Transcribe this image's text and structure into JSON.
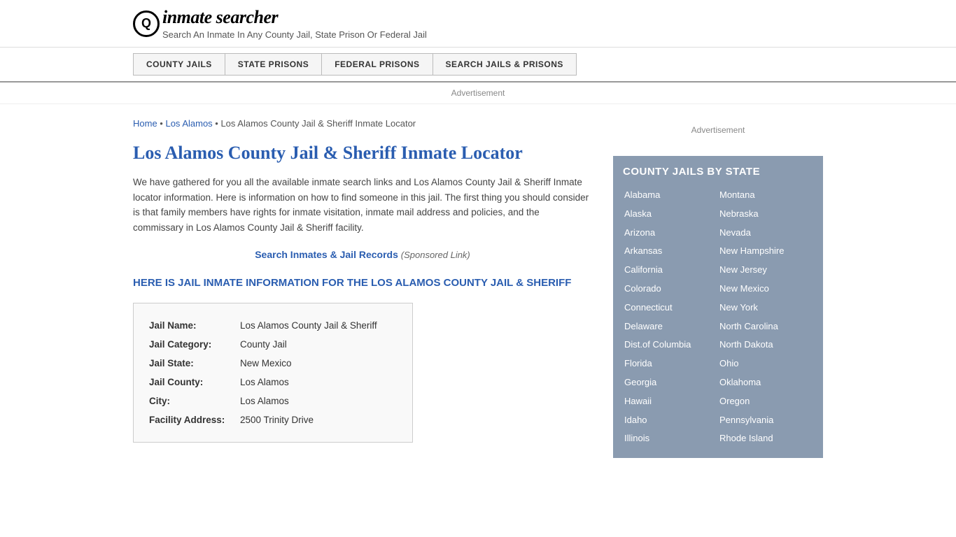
{
  "header": {
    "logo_icon": "🔍",
    "logo_text": "inmate searcher",
    "tagline": "Search An Inmate In Any County Jail, State Prison Or Federal Jail"
  },
  "nav": {
    "items": [
      {
        "id": "county-jails",
        "label": "COUNTY JAILS"
      },
      {
        "id": "state-prisons",
        "label": "STATE PRISONS"
      },
      {
        "id": "federal-prisons",
        "label": "FEDERAL PRISONS"
      },
      {
        "id": "search-jails",
        "label": "SEARCH JAILS & PRISONS"
      }
    ]
  },
  "ad_label": "Advertisement",
  "breadcrumb": {
    "home": "Home",
    "parent": "Los Alamos",
    "current": "Los Alamos County Jail & Sheriff Inmate Locator"
  },
  "page_title": "Los Alamos County Jail & Sheriff Inmate Locator",
  "description": "We have gathered for you all the available inmate search links and Los Alamos County Jail & Sheriff Inmate locator information. Here is information on how to find someone in this jail. The first thing you should consider is that family members have rights for inmate visitation, inmate mail address and policies, and the commissary in Los Alamos County Jail & Sheriff facility.",
  "search_link": {
    "text": "Search Inmates & Jail Records",
    "sponsored": "(Sponsored Link)"
  },
  "section_heading": "HERE IS JAIL INMATE INFORMATION FOR THE LOS ALAMOS COUNTY JAIL & SHERIFF",
  "jail_info": {
    "name_label": "Jail Name:",
    "name_value": "Los Alamos County Jail & Sheriff",
    "category_label": "Jail Category:",
    "category_value": "County Jail",
    "state_label": "Jail State:",
    "state_value": "New Mexico",
    "county_label": "Jail County:",
    "county_value": "Los Alamos",
    "city_label": "City:",
    "city_value": "Los Alamos",
    "address_label": "Facility Address:",
    "address_value": "2500 Trinity Drive"
  },
  "sidebar": {
    "ad_label": "Advertisement",
    "state_box_title": "COUNTY JAILS BY STATE",
    "states_left": [
      "Alabama",
      "Alaska",
      "Arizona",
      "Arkansas",
      "California",
      "Colorado",
      "Connecticut",
      "Delaware",
      "Dist.of Columbia",
      "Florida",
      "Georgia",
      "Hawaii",
      "Idaho",
      "Illinois"
    ],
    "states_right": [
      "Montana",
      "Nebraska",
      "Nevada",
      "New Hampshire",
      "New Jersey",
      "New Mexico",
      "New York",
      "North Carolina",
      "North Dakota",
      "Ohio",
      "Oklahoma",
      "Oregon",
      "Pennsylvania",
      "Rhode Island"
    ]
  }
}
